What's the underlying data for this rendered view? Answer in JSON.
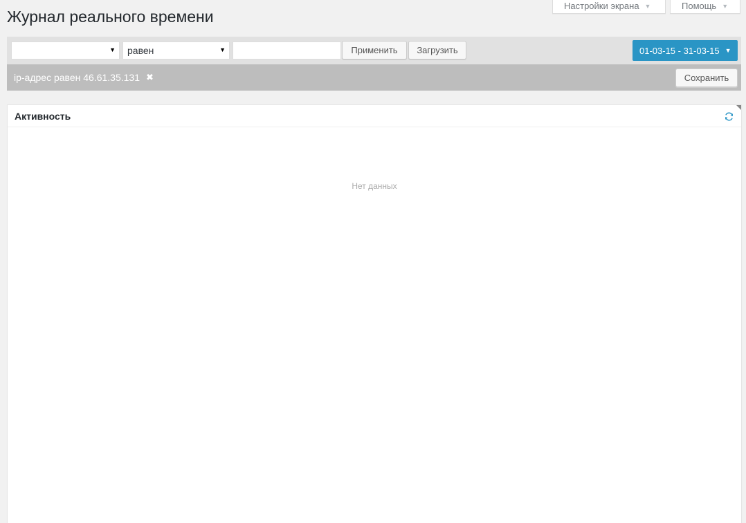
{
  "page": {
    "title": "Журнал реального времени"
  },
  "screen_meta": {
    "screen_options_label": "Настройки экрана",
    "help_label": "Помощь"
  },
  "filter_bar": {
    "field_select_value": "",
    "operator_select_value": "равен",
    "value_input": "",
    "apply_label": "Применить",
    "load_label": "Загрузить",
    "date_range": "01-03-15 - 31-03-15"
  },
  "active_filter": {
    "text": "ip-адрес равен 46.61.35.131",
    "save_label": "Сохранить"
  },
  "activity_panel": {
    "title": "Активность",
    "empty_text": "Нет данных"
  },
  "colors": {
    "accent": "#2a95c5",
    "filter_bar_bg": "#e1e1e1",
    "active_filter_bg": "#bdbdbd",
    "page_bg": "#f1f1f1"
  },
  "icons": {
    "screen_options_arrow": "triangle-down-icon",
    "help_arrow": "triangle-down-icon",
    "select_caret": "caret-down-icon",
    "date_caret": "caret-down-icon",
    "remove_filter": "close-icon",
    "refresh": "refresh-icon"
  }
}
